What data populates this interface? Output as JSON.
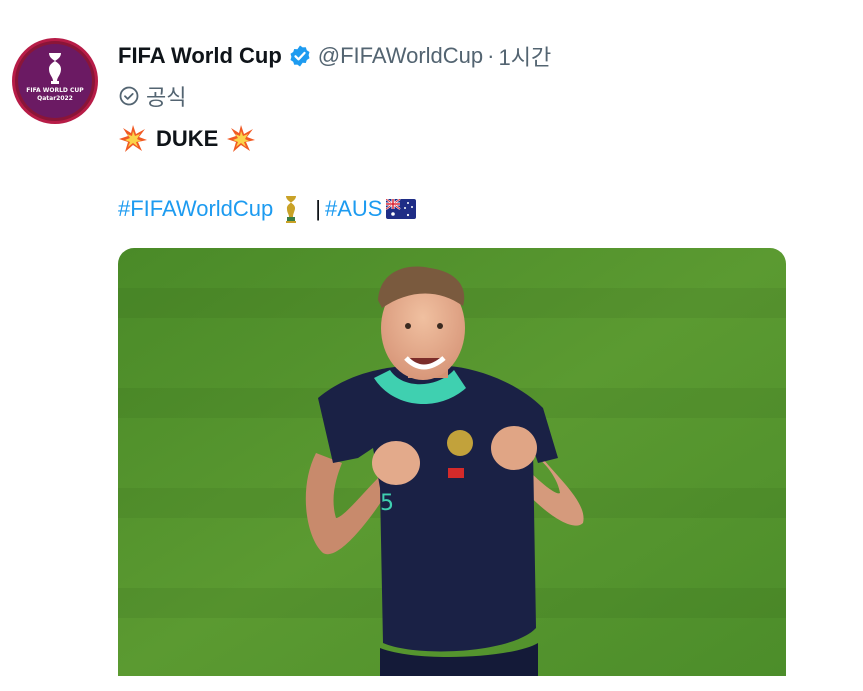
{
  "author": {
    "display_name": "FIFA World Cup",
    "handle": "@FIFAWorldCup",
    "separator": "·",
    "time": "1시간",
    "official_label": "공식",
    "avatar_lines": [
      "FIFA WORLD CUP",
      "Qatar2022"
    ]
  },
  "tweet": {
    "text": "DUKE",
    "emoji_left": "💥",
    "emoji_right": "💥",
    "hashtag_1": "#FIFAWorldCup",
    "separator": "|",
    "hashtag_2": "#AUS"
  },
  "icons": {
    "verified": "verified-badge-icon",
    "official": "check-circle-icon",
    "trophy": "trophy-icon",
    "flag": "australia-flag-icon"
  },
  "colors": {
    "accent": "#1d9bf0",
    "secondary_text": "#536471",
    "primary_text": "#0f1419",
    "avatar_bg": "#6b1a63",
    "avatar_ring": "#b71c47",
    "pitch_green": "#4f8f2a",
    "jersey_navy": "#1a2145",
    "jersey_teal": "#3fd0b0"
  }
}
